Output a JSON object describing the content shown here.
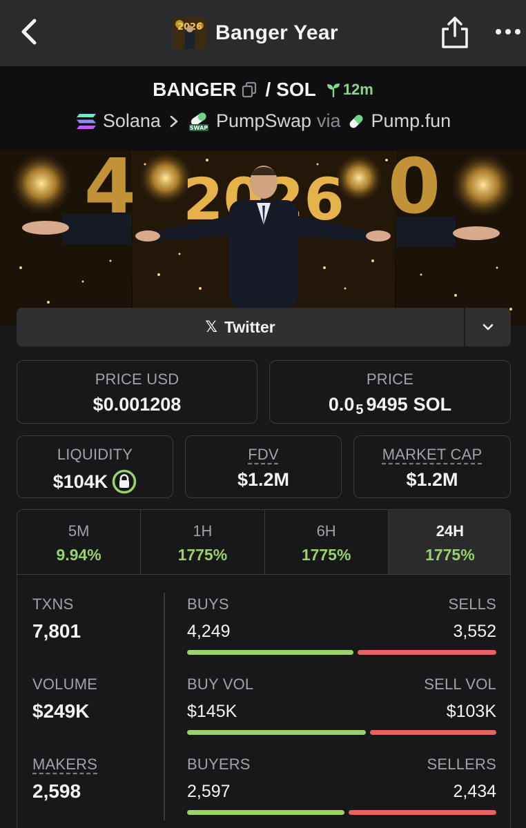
{
  "nav": {
    "title": "Banger Year",
    "thumb_text": "2026"
  },
  "pair": {
    "base": "BANGER",
    "separator": "/",
    "quote": "SOL",
    "age": "12m",
    "chain": "Solana",
    "dex": "PumpSwap",
    "dex_badge": "SWAP",
    "via_label": "via",
    "launchpad": "Pump.fun"
  },
  "banner": {
    "year_text": "2026"
  },
  "links": {
    "twitter_label": "Twitter",
    "twitter_glyph": "𝕏"
  },
  "price": {
    "usd_label": "PRICE USD",
    "usd_value": "$0.001208",
    "native_label": "PRICE",
    "native_prefix": "0.0",
    "native_zero_count": "5",
    "native_digits": "9495",
    "native_unit": "SOL"
  },
  "metrics": {
    "liquidity_label": "LIQUIDITY",
    "liquidity_value": "$104K",
    "fdv_label": "FDV",
    "fdv_value": "$1.2M",
    "mcap_label": "MARKET CAP",
    "mcap_value": "$1.2M"
  },
  "timeframes": [
    {
      "label": "5M",
      "change": "9.94%"
    },
    {
      "label": "1H",
      "change": "1775%"
    },
    {
      "label": "6H",
      "change": "1775%"
    },
    {
      "label": "24H",
      "change": "1775%"
    }
  ],
  "stats": {
    "txns_label": "TXNS",
    "txns_value": "7,801",
    "volume_label": "VOLUME",
    "volume_value": "$249K",
    "makers_label": "MAKERS",
    "makers_value": "2,598",
    "buys_label": "BUYS",
    "buys_value": "4,249",
    "sells_label": "SELLS",
    "sells_value": "3,552",
    "buy_vol_label": "BUY VOL",
    "buy_vol_value": "$145K",
    "sell_vol_label": "SELL VOL",
    "sell_vol_value": "$103K",
    "buyers_label": "BUYERS",
    "buyers_value": "2,597",
    "sellers_label": "SELLERS",
    "sellers_value": "2,434"
  },
  "ratios": {
    "buys_fraction": 0.545,
    "buy_vol_fraction": 0.585,
    "buyers_fraction": 0.516
  },
  "colors": {
    "positive": "#9ad16a",
    "negative": "#e5645f",
    "age": "#86d68b"
  }
}
